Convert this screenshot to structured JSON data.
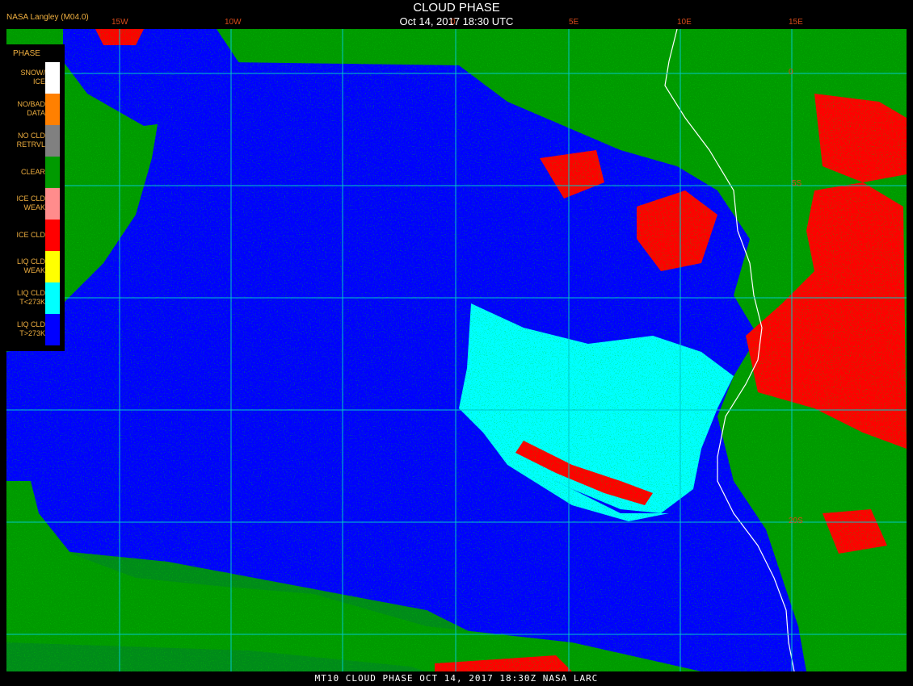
{
  "header": {
    "credit": "NASA Langley (M04.0)",
    "title": "CLOUD PHASE",
    "datetime": "Oct 14, 2017 18:30 UTC"
  },
  "footer": {
    "text": "MT10  CLOUD PHASE   OCT 14, 2017 18:30Z   NASA LARC"
  },
  "legend": {
    "title": "PHASE",
    "items": [
      {
        "label_lines": [
          "SNOW/",
          "ICE"
        ],
        "color": "#ffffff"
      },
      {
        "label_lines": [
          "NO/BAD",
          "DATA"
        ],
        "color": "#ff8000"
      },
      {
        "label_lines": [
          "NO CLD",
          "RETRVL"
        ],
        "color": "#808080"
      },
      {
        "label_lines": [
          "CLEAR"
        ],
        "color": "#009a00"
      },
      {
        "label_lines": [
          "ICE CLD",
          "WEAK"
        ],
        "color": "#ff8c8c"
      },
      {
        "label_lines": [
          "ICE CLD"
        ],
        "color": "#ff0000"
      },
      {
        "label_lines": [
          "LIQ CLD",
          "WEAK"
        ],
        "color": "#ffff00"
      },
      {
        "label_lines": [
          "LIQ CLD",
          "T<273K"
        ],
        "color": "#00ffff"
      },
      {
        "label_lines": [
          "LIQ CLD",
          "T>273K"
        ],
        "color": "#0000ff"
      }
    ]
  },
  "grid": {
    "longitude_labels": [
      "15W",
      "10W",
      "0",
      "5E",
      "10E",
      "15E"
    ],
    "latitude_labels": [
      "0",
      "5S",
      "20S"
    ]
  },
  "colors": {
    "clear": "#009a00",
    "liq_warm": "#0000ff",
    "liq_cold": "#00ffff",
    "ice": "#ff0000",
    "gridline": "#00c8c8",
    "coast": "#ffffff"
  }
}
